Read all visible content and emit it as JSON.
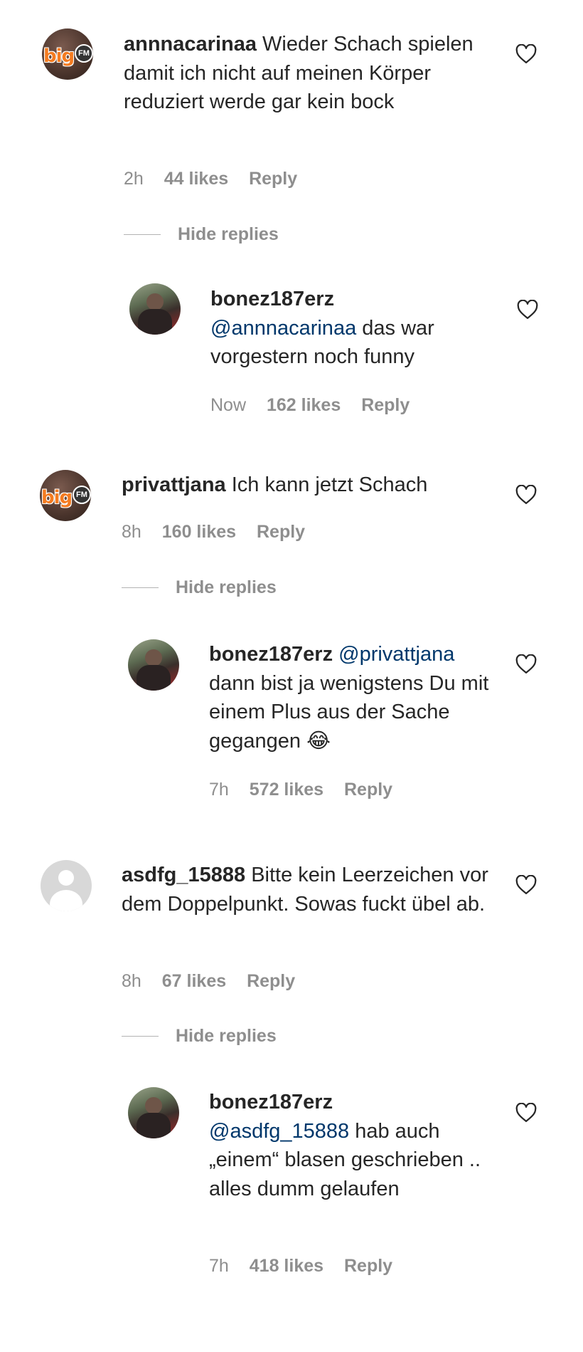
{
  "comments": [
    {
      "username": "annnacarinaa",
      "text": "Wieder Schach spielen damit ich nicht auf meinen Körper reduziert werde gar kein bock",
      "time": "2h",
      "likes": "44 likes",
      "reply_label": "Reply",
      "hide_replies_label": "Hide replies",
      "reply": {
        "username": "bonez187erz",
        "mention": "@annnacarinaa",
        "text": "das war vorgestern noch funny",
        "time": "Now",
        "likes": "162 likes",
        "reply_label": "Reply"
      }
    },
    {
      "username": "privattjana",
      "text": "Ich kann jetzt Schach",
      "time": "8h",
      "likes": "160 likes",
      "reply_label": "Reply",
      "hide_replies_label": "Hide replies",
      "reply": {
        "username": "bonez187erz",
        "mention": "@privattjana",
        "text": "dann bist ja wenigstens Du mit einem Plus aus der Sache gegangen 😂",
        "time": "7h",
        "likes": "572 likes",
        "reply_label": "Reply"
      }
    },
    {
      "username": "asdfg_15888",
      "text": "Bitte kein Leerzeichen vor dem Doppelpunkt. Sowas fuckt übel ab.",
      "time": "8h",
      "likes": "67 likes",
      "reply_label": "Reply",
      "hide_replies_label": "Hide replies",
      "reply": {
        "username": "bonez187erz",
        "mention": "@asdfg_15888",
        "text": "hab auch „einem“ blasen geschrieben .. alles dumm gelaufen",
        "time": "7h",
        "likes": "418 likes",
        "reply_label": "Reply"
      }
    }
  ],
  "avatar_logo_text": "big",
  "avatar_logo_badge": "FM",
  "icons": {
    "like": "heart-outline-icon"
  }
}
